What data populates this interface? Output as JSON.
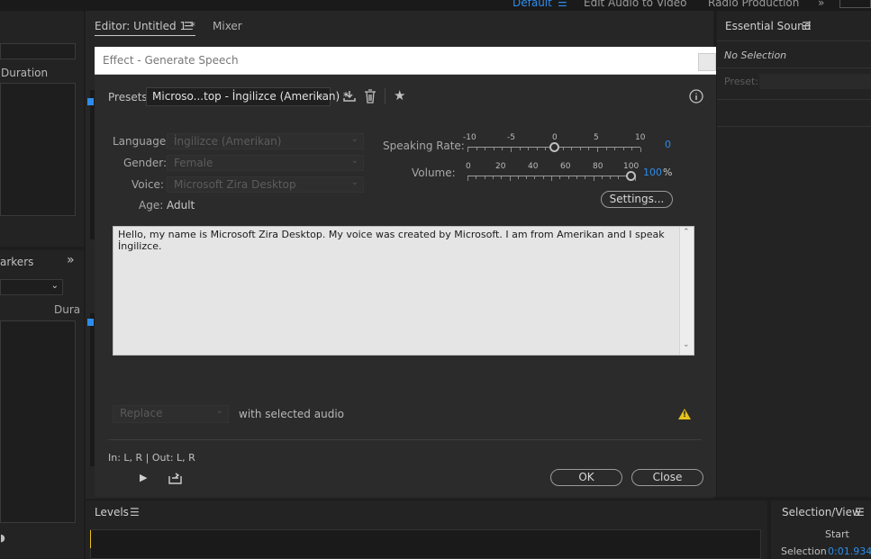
{
  "workspace": {
    "items": [
      "Default",
      "Edit Audio to Video",
      "Radio Production"
    ]
  },
  "editor": {
    "tabs": [
      {
        "label": "Editor: Untitled 1 *"
      },
      {
        "label": "Mixer"
      }
    ]
  },
  "left": {
    "duration_label": "Duration",
    "markers_label": "arkers",
    "dura_label": "Dura"
  },
  "dialog": {
    "title": "Effect - Generate Speech",
    "presets_label": "Presets:",
    "preset_value": "Microso...top - İngilizce (Amerikan) *",
    "language_label": "Language:",
    "language_value": "İngilizce (Amerikan)",
    "gender_label": "Gender:",
    "gender_value": "Female",
    "voice_label": "Voice:",
    "voice_value": "Microsoft Zira Desktop",
    "age_label": "Age:",
    "age_value": "Adult",
    "speaking_rate_label": "Speaking Rate:",
    "speaking_rate_ticks": [
      "-10",
      "-5",
      "0",
      "5",
      "10"
    ],
    "speaking_rate_value": "0",
    "volume_label": "Volume:",
    "volume_ticks": [
      "0",
      "20",
      "40",
      "60",
      "80",
      "100"
    ],
    "volume_value": "100",
    "volume_unit": "%",
    "settings_button": "Settings...",
    "text": "Hello, my name is Microsoft Zira Desktop. My voice was created by Microsoft. I am from Amerikan and I speak İngilizce.",
    "replace_value": "Replace",
    "with_selected_audio": "with selected audio",
    "io_label": "In: L, R | Out: L, R",
    "ok_button": "OK",
    "close_button": "Close"
  },
  "essential_sound": {
    "title": "Essential Sound",
    "no_selection": "No Selection",
    "preset_label": "Preset:"
  },
  "levels": {
    "title": "Levels"
  },
  "selection_view": {
    "title": "Selection/View",
    "start_label": "Start",
    "selection_label": "Selection",
    "selection_start": "0:01.934"
  },
  "colors": {
    "accent": "#2d8ceb",
    "warning": "#e8c21a"
  }
}
